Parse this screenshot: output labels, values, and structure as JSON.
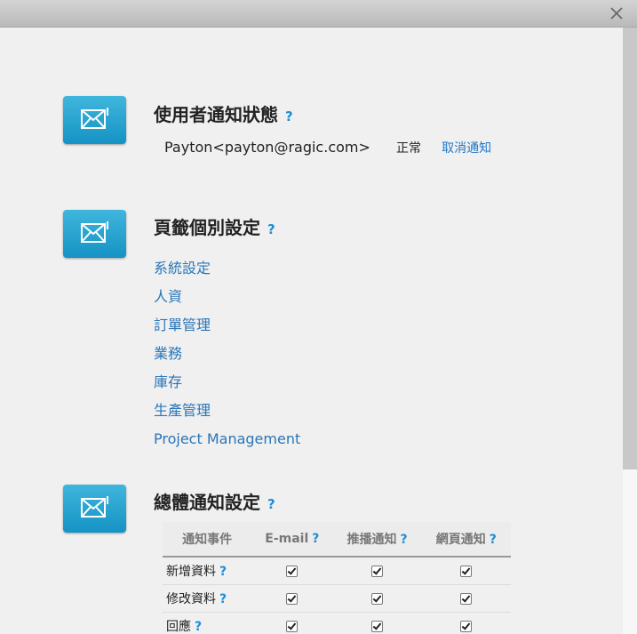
{
  "sections": {
    "status": {
      "title": "使用者通知狀態",
      "help": "?",
      "user": "Payton<payton@ragic.com>",
      "state": "正常",
      "cancel_label": "取消通知"
    },
    "tabs": {
      "title": "頁籤個別設定",
      "help": "?",
      "links": [
        "系統設定",
        "人資",
        "訂單管理",
        "業務",
        "庫存",
        "生產管理",
        "Project Management"
      ]
    },
    "general": {
      "title": "總體通知設定",
      "help": "?",
      "table": {
        "headers": {
          "event": "通知事件",
          "email": "E-mail",
          "push": "推播通知",
          "web": "網頁通知"
        },
        "rows": [
          {
            "event": "新增資料",
            "email": true,
            "push": true,
            "web": true
          },
          {
            "event": "修改資料",
            "email": true,
            "push": true,
            "web": true
          },
          {
            "event": "回應",
            "email": true,
            "push": true,
            "web": true
          }
        ]
      }
    }
  },
  "icons": {
    "close": "close-icon",
    "mail": "mail-icon"
  },
  "colors": {
    "accent": "#1f8dd6",
    "link": "#2a75b8",
    "tile": "#28a7d3"
  }
}
